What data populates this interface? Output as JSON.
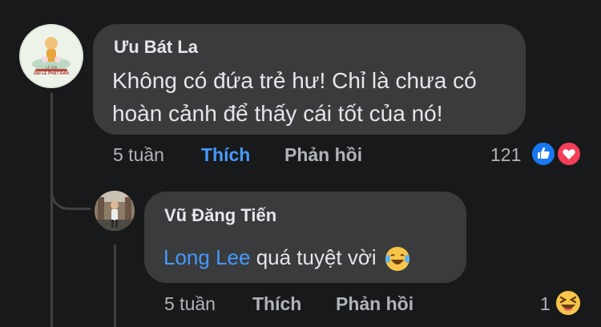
{
  "comment": {
    "author": "Ưu Bát La",
    "text_line1": "Không có đứa trẻ hư! Chỉ là chưa có",
    "text_line2": "hoàn cảnh để thấy cái tốt của nó!",
    "time": "5 tuần",
    "like_label": "Thích",
    "reply_label": "Phản hồi",
    "reaction_count": "121",
    "reactions": [
      "like-icon",
      "love-icon"
    ],
    "avatar_text_top": "Lễ Hội",
    "avatar_text_bottom": "ĐẠI LỄ PHẬT ĐẢN"
  },
  "reply": {
    "author": "Vũ Đăng Tiến",
    "mention": "Long Lee",
    "text": "quá tuyệt vời",
    "emoji": "laughing-tears-emoji",
    "time": "5 tuần",
    "like_label": "Thích",
    "reply_label": "Phản hồi",
    "reaction_count": "1",
    "reactions": [
      "haha-icon"
    ]
  },
  "colors": {
    "background": "#18191a",
    "bubble": "#3a3b3c",
    "accent_link": "#4599ff",
    "like_blue": "#1877f2",
    "love_red": "#f33e58",
    "secondary_text": "#b0b3b8"
  }
}
